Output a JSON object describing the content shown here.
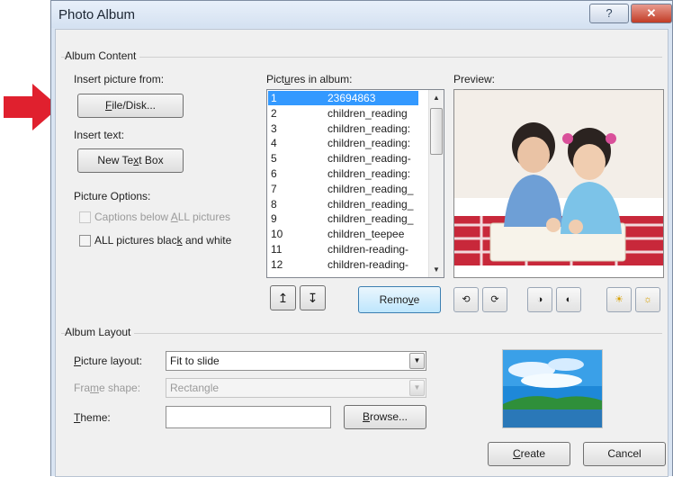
{
  "window": {
    "title": "Photo Album",
    "help_glyph": "?",
    "close_glyph": "✕"
  },
  "album_content": {
    "group_title": "Album Content",
    "insert_picture_from": "Insert picture from:",
    "file_disk_button": {
      "pre": "",
      "ul": "F",
      "post": "ile/Disk..."
    },
    "insert_text": "Insert text:",
    "new_text_box_button": {
      "pre": "New Te",
      "ul": "x",
      "post": "t Box"
    },
    "picture_options": "Picture Options:",
    "captions_option": {
      "pre": "Captions below ",
      "ul": "A",
      "post": "LL pictures",
      "checked": false,
      "enabled": false
    },
    "black_white_option": {
      "pre": "ALL pictures blac",
      "ul": "k",
      "post": " and white",
      "checked": false,
      "enabled": true
    }
  },
  "pictures_in_album": {
    "label_pre": "Pict",
    "label_ul": "u",
    "label_post": "res in album:",
    "items": [
      {
        "num": "1",
        "name": "23694863",
        "selected": true
      },
      {
        "num": "2",
        "name": "children_reading",
        "selected": false
      },
      {
        "num": "3",
        "name": "children_reading:",
        "selected": false
      },
      {
        "num": "4",
        "name": "children_reading:",
        "selected": false
      },
      {
        "num": "5",
        "name": "children_reading-",
        "selected": false
      },
      {
        "num": "6",
        "name": "children_reading:",
        "selected": false
      },
      {
        "num": "7",
        "name": "children_reading_",
        "selected": false
      },
      {
        "num": "8",
        "name": "children_reading_",
        "selected": false
      },
      {
        "num": "9",
        "name": "children_reading_",
        "selected": false
      },
      {
        "num": "10",
        "name": "children_teepee",
        "selected": false
      },
      {
        "num": "11",
        "name": "children-reading-",
        "selected": false
      },
      {
        "num": "12",
        "name": "children-reading-",
        "selected": false
      }
    ],
    "move_up_glyph": "↥",
    "move_down_glyph": "↧",
    "remove_button": {
      "pre": "Remo",
      "ul": "v",
      "post": "e"
    }
  },
  "preview": {
    "label": "Preview:",
    "icons": [
      "rotate-left-icon",
      "rotate-right-icon",
      "contrast-more-icon",
      "contrast-less-icon",
      "brightness-more-icon",
      "brightness-less-icon"
    ]
  },
  "album_layout": {
    "group_title": "Album Layout",
    "picture_layout_label": {
      "pre": "",
      "ul": "P",
      "post": "icture layout:"
    },
    "picture_layout_value": "Fit to slide",
    "frame_shape_label": {
      "pre": "Fra",
      "ul": "m",
      "post": "e shape:"
    },
    "frame_shape_value": "Rectangle",
    "theme_label": {
      "pre": "",
      "ul": "T",
      "post": "heme:"
    },
    "theme_value": "",
    "browse_button": {
      "pre": "",
      "ul": "B",
      "post": "rowse..."
    }
  },
  "footer": {
    "create_button": {
      "pre": "",
      "ul": "C",
      "post": "reate"
    },
    "cancel_button": "Cancel"
  },
  "colors": {
    "arrow": "#e0202e",
    "selection": "#3399ff",
    "title_bg": "#d4e1f1"
  }
}
